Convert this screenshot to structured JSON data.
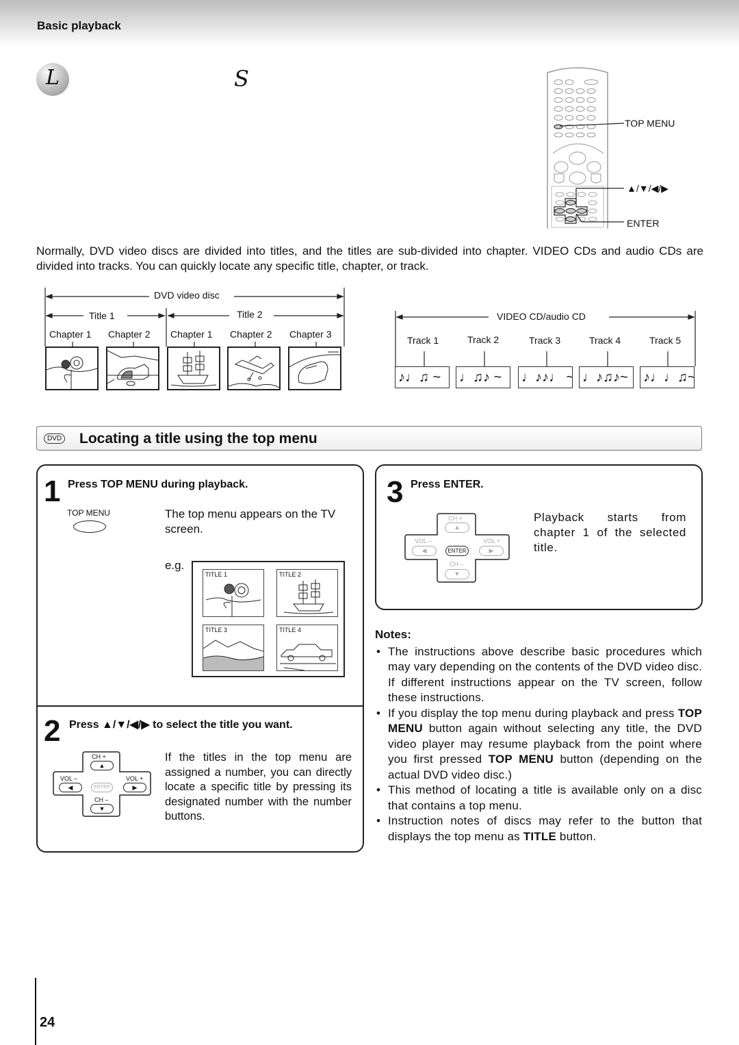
{
  "header": {
    "section": "Basic playback"
  },
  "heading": {
    "ball_letter": "L",
    "second_letter": "S"
  },
  "remote": {
    "labels": {
      "top_menu": "TOP MENU",
      "arrows": "▲/▼/◀/▶",
      "enter": "ENTER"
    }
  },
  "intro": "Normally, DVD video discs are divided into titles, and the titles are sub-divided into chapter. VIDEO CDs and audio CDs are divided into tracks. You can quickly locate any specific title, chapter, or track.",
  "dvd_diagram": {
    "disc_label": "DVD video disc",
    "titles": [
      {
        "label": "Title 1",
        "chapters": [
          "Chapter 1",
          "Chapter 2"
        ]
      },
      {
        "label": "Title 2",
        "chapters": [
          "Chapter 1",
          "Chapter 2",
          "Chapter 3"
        ]
      }
    ],
    "thumbs": [
      "sunflowers",
      "cat",
      "ship",
      "airplane",
      "car"
    ]
  },
  "cd_diagram": {
    "disc_label": "VIDEO CD/audio CD",
    "tracks": [
      {
        "label": "Track 1",
        "notes": "♪♩♫ ~"
      },
      {
        "label": "Track 2",
        "notes": "♩♫♪ ~"
      },
      {
        "label": "Track 3",
        "notes": "♩♪♪♩ ~"
      },
      {
        "label": "Track 4",
        "notes": "♩♪♫♪~"
      },
      {
        "label": "Track 5",
        "notes": "♪♩♩♫~"
      }
    ]
  },
  "section_bar": {
    "badge": "DVD",
    "title": "Locating a title using the top menu"
  },
  "steps": [
    {
      "number": "1",
      "title": "Press TOP MENU during playback.",
      "button_label": "TOP MENU",
      "text": "The top menu appears on the TV screen.",
      "eg": "e.g.",
      "menu_titles": [
        "TITLE 1",
        "TITLE 2",
        "TITLE 3",
        "TITLE 4"
      ]
    },
    {
      "number": "2",
      "title_prefix": "Press",
      "title_arrows": "▲/▼/◀/▶",
      "title_suffix": "to select the title you want.",
      "text": "If the titles in the top menu are assigned a number, you can directly locate a specific title by pressing its designated number with the number buttons."
    },
    {
      "number": "3",
      "title": "Press ENTER.",
      "text": "Playback starts from chapter 1 of the selected title."
    }
  ],
  "dpad": {
    "ch_plus": "CH +",
    "ch_minus": "CH –",
    "vol_minus": "VOL –",
    "vol_plus": "VOL +",
    "enter": "ENTER",
    "up": "▲",
    "down": "▼",
    "left": "◀",
    "right": "▶"
  },
  "notes": {
    "heading": "Notes:",
    "items": [
      {
        "pre": "The instructions above describe basic procedures which may vary depending on the contents of the DVD video disc. If different instructions appear on the TV screen, follow these instructions.",
        "bold": "",
        "post": ""
      },
      {
        "pre": "If you display the top menu during playback and press ",
        "bold": "TOP MENU",
        "post": " button again without selecting any title, the DVD video player may resume playback from the point where you first pressed ",
        "bold2": "TOP MENU",
        "post2": " button (depending on the actual DVD video disc.)"
      },
      {
        "pre": "This method of locating a title is available only on a disc that contains a top menu.",
        "bold": "",
        "post": ""
      },
      {
        "pre": "Instruction notes of discs may refer to the button that displays the top menu as ",
        "bold": "TITLE",
        "post": " button."
      }
    ]
  },
  "page_number": "24"
}
